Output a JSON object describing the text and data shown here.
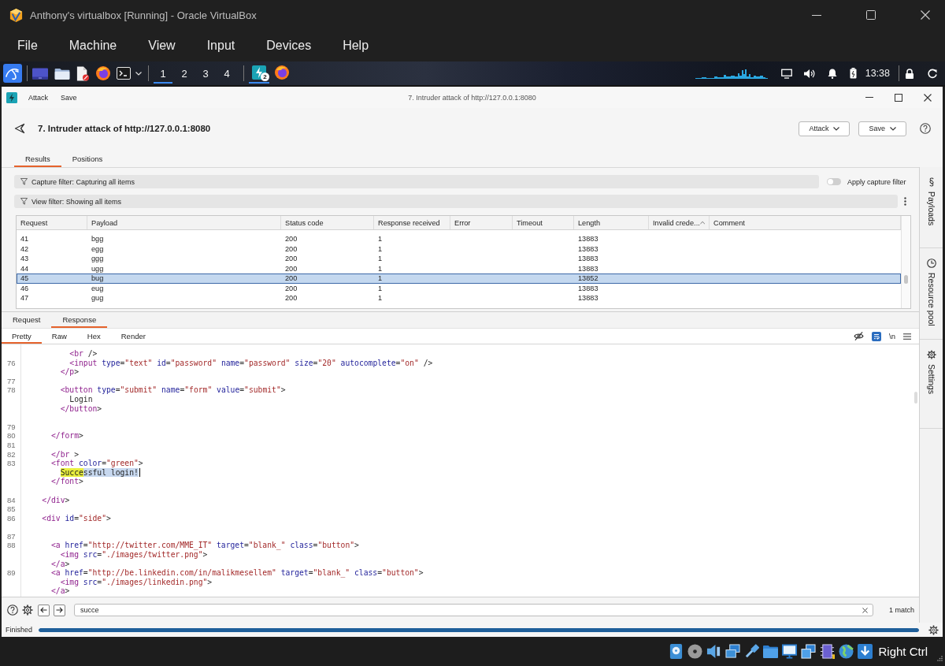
{
  "window": {
    "title": "Anthony's virtualbox [Running] - Oracle VirtualBox"
  },
  "menu": [
    "File",
    "Machine",
    "View",
    "Input",
    "Devices",
    "Help"
  ],
  "panel": {
    "workspaces": [
      {
        "label": "1",
        "selected": true
      },
      {
        "label": "2",
        "selected": false
      },
      {
        "label": "3",
        "selected": false
      },
      {
        "label": "4",
        "selected": false
      }
    ],
    "tasks": [
      {
        "kind": "burp",
        "badge": "2",
        "selected": true
      },
      {
        "kind": "firefox",
        "selected": false
      }
    ],
    "clock": "13:38"
  },
  "burp": {
    "menu": [
      "Attack",
      "Save"
    ],
    "title": "7. Intruder attack of http://127.0.0.1:8080",
    "heading": "7. Intruder attack of http://127.0.0.1:8080",
    "actions": [
      "Attack",
      "Save"
    ],
    "tabs": [
      {
        "label": "Results",
        "selected": true
      },
      {
        "label": "Positions",
        "selected": false
      }
    ],
    "capture_filter": "Capture filter: Capturing all items",
    "capture_toggle": {
      "label": "Apply capture filter",
      "on": false
    },
    "view_filter": "View filter: Showing all items",
    "table": {
      "columns": [
        {
          "label": "Request",
          "sorted": false
        },
        {
          "label": "Payload",
          "sorted": false
        },
        {
          "label": "Status code",
          "sorted": false
        },
        {
          "label": "Response received",
          "sorted": false
        },
        {
          "label": "Error",
          "sorted": false
        },
        {
          "label": "Timeout",
          "sorted": false
        },
        {
          "label": "Length",
          "sorted": false
        },
        {
          "label": "Invalid crede...",
          "sorted": true
        },
        {
          "label": "Comment",
          "sorted": false
        }
      ],
      "rows": [
        {
          "cells": [
            "41",
            "bgg",
            "200",
            "1",
            null,
            null,
            "13883"
          ],
          "selected": false
        },
        {
          "cells": [
            "42",
            "egg",
            "200",
            "1",
            null,
            null,
            "13883"
          ],
          "selected": false
        },
        {
          "cells": [
            "43",
            "ggg",
            "200",
            "1",
            null,
            null,
            "13883"
          ],
          "selected": false
        },
        {
          "cells": [
            "44",
            "ugg",
            "200",
            "1",
            null,
            null,
            "13883"
          ],
          "selected": false
        },
        {
          "cells": [
            "45",
            "bug",
            "200",
            "1",
            null,
            null,
            "13852"
          ],
          "selected": true
        },
        {
          "cells": [
            "46",
            "eug",
            "200",
            "1",
            null,
            null,
            "13883"
          ],
          "selected": false
        },
        {
          "cells": [
            "47",
            "gug",
            "200",
            "1",
            null,
            null,
            "13883"
          ],
          "selected": false
        }
      ]
    },
    "sidebar": [
      "Payloads",
      "Resource pool",
      "Settings"
    ],
    "message": {
      "tabs": [
        {
          "label": "Request",
          "selected": false
        },
        {
          "label": "Response",
          "selected": true
        }
      ],
      "view_tabs": [
        {
          "label": "Pretty",
          "selected": true
        },
        {
          "label": "Raw",
          "selected": false
        },
        {
          "label": "Hex",
          "selected": false
        },
        {
          "label": "Render",
          "selected": false
        }
      ],
      "wrap_lines": true,
      "newline_toggle": "\\n",
      "lines": [
        {
          "kind": "code",
          "text": "          <br />"
        },
        {
          "kind": "code",
          "number": "76",
          "text": "          <input type=\"text\" id=\"password\" name=\"password\" size=\"20\" autocomplete=\"on\" />"
        },
        {
          "kind": "code",
          "text": "        </p>"
        },
        {
          "kind": "code",
          "number": "77"
        },
        {
          "kind": "code",
          "number": "78",
          "text": "        <button type=\"submit\" name=\"form\" value=\"submit\">"
        },
        {
          "kind": "code",
          "text": "          Login"
        },
        {
          "kind": "code",
          "text": "        </button>"
        },
        {
          "kind": "blank"
        },
        {
          "kind": "code",
          "number": "79"
        },
        {
          "kind": "code",
          "number": "80",
          "text": "      </form>"
        },
        {
          "kind": "code",
          "number": "81"
        },
        {
          "kind": "code",
          "number": "82",
          "text": "      </br >"
        },
        {
          "kind": "code",
          "number": "83",
          "text": "      <font color=\"green\">"
        },
        {
          "kind": "code",
          "parts": [
            {
              "text": "        Succe",
              "kind": "match"
            },
            {
              "text": "ssful login!",
              "kind": "selection"
            }
          ],
          "caret": true
        },
        {
          "kind": "code",
          "text": "      </font>"
        },
        {
          "kind": "blank"
        },
        {
          "kind": "code",
          "number": "84",
          "text": "    </div>"
        },
        {
          "kind": "code",
          "number": "85"
        },
        {
          "kind": "code",
          "number": "86",
          "text": "    <div id=\"side\">"
        },
        {
          "kind": "blank"
        },
        {
          "kind": "code",
          "number": "87"
        },
        {
          "kind": "code",
          "number": "88",
          "text": "      <a href=\"http://twitter.com/MME_IT\" target=\"blank_\" class=\"button\">"
        },
        {
          "kind": "code",
          "text": "        <img src=\"./images/twitter.png\">"
        },
        {
          "kind": "code",
          "text": "      </a>"
        },
        {
          "kind": "code",
          "number": "89",
          "text": "      <a href=\"http://be.linkedin.com/in/malikmesellem\" target=\"blank_\" class=\"button\">"
        },
        {
          "kind": "code",
          "text": "        <img src=\"./images/linkedin.png\">"
        },
        {
          "kind": "code",
          "text": "      </a>"
        }
      ]
    },
    "search": {
      "value": "succe",
      "result": "1 match"
    },
    "status": {
      "text": "Finished",
      "level": 1
    }
  },
  "host_key": "Right Ctrl"
}
